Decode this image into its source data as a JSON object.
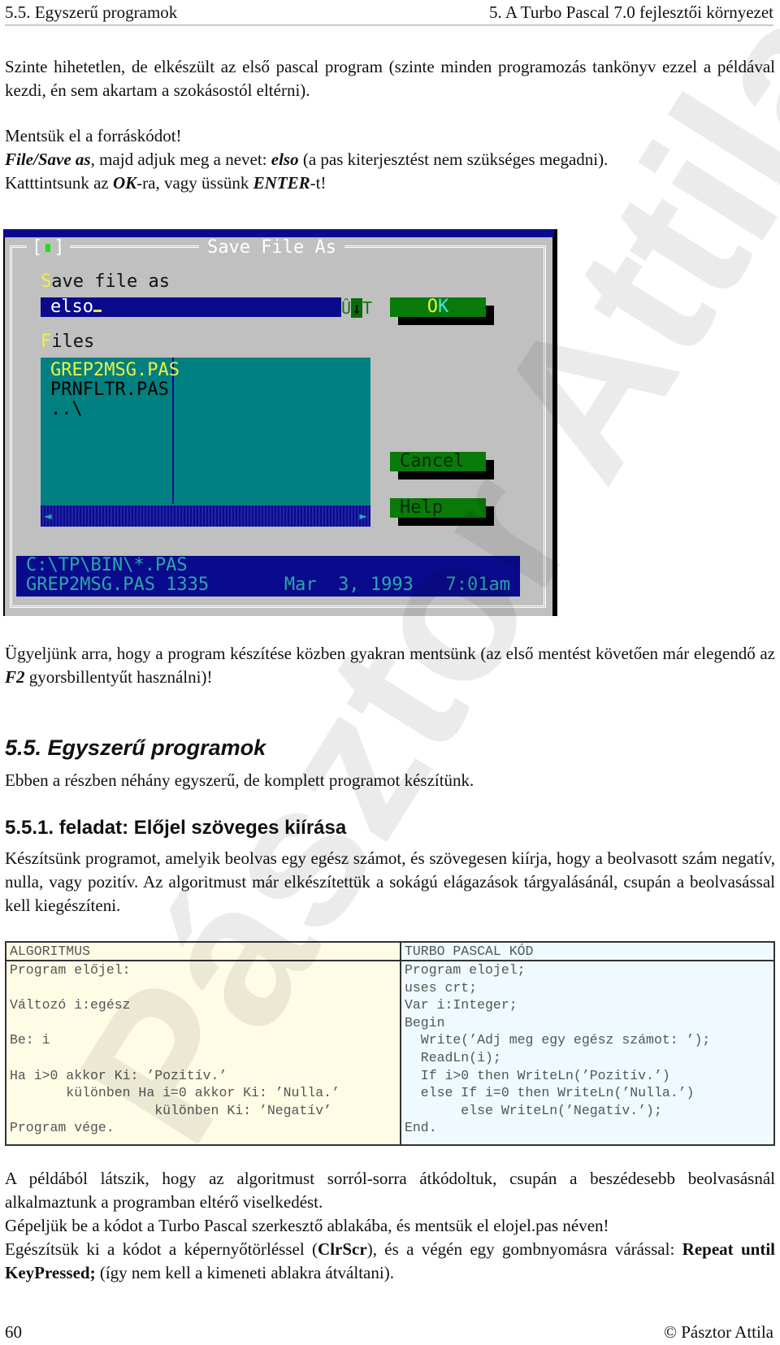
{
  "running_header": {
    "left": "5.5. Egyszerű programok",
    "right": "5. A Turbo Pascal 7.0 fejlesztői környezet"
  },
  "paragraphs": {
    "p1": "Szinte hihetetlen, de elkészült az első pascal program (szinte minden programozás tankönyv ezzel a példával kezdi, én sem akartam a szokásostól eltérni).",
    "p2_line1": "Mentsük el a forráskódot!",
    "p2_line2_bold1": "File/Save as",
    "p2_line2_text1": ", majd adjuk meg a nevet: ",
    "p2_line2_bold2": "elso",
    "p2_line2_text2": " (a pas kiterjesztést nem szükséges megadni).",
    "p2_line3_text1": "Katttintsunk az ",
    "p2_line3_bold1": "OK",
    "p2_line3_text2": "-ra, vagy üssünk ",
    "p2_line3_bold2": "ENTER",
    "p2_line3_text3": "-t!",
    "p3_text1": "Ügyeljünk arra, hogy a program készítése közben gyakran mentsünk (az első mentést követően már elegendő az ",
    "p3_bold": "F2",
    "p3_text2": " gyorsbillentyűt használni)!",
    "p4": "Ebben a részben néhány egyszerű, de komplett programot készítünk.",
    "p5": "Készítsünk programot, amelyik beolvas egy egész számot, és szövegesen kiírja, hogy a beolvasott szám negatív, nulla, vagy pozitív. Az algoritmust már elkészítettük a sokágú elágazások tárgyalásánál, csupán a beolvasással kell kiegészíteni.",
    "p6": "A példából látszik, hogy az algoritmust sorról-sorra átkódoltuk, csupán a beszédesebb beolvasásnál alkalmaztunk a programban eltérő viselkedést.",
    "p7": "Gépeljük be a kódot a Turbo Pascal szerkesztő ablakába, és mentsük el elojel.pas néven!",
    "p8_text1": "Egészítsük ki a kódot a képernyőtörléssel (",
    "p8_bold1": "ClrScr",
    "p8_text2": "), és a végén egy gombnyomásra várással: ",
    "p8_bold2": "Repeat until KeyPressed;",
    "p8_text3": " (így nem kell a kimeneti ablakra átváltani)."
  },
  "headings": {
    "section": "5.5. Egyszerű programok",
    "task": "5.5.1. feladat: Előjel szöveges kiírása"
  },
  "dialog": {
    "title": "Save File As",
    "close_icon": "close-box-icon",
    "save_label_hot": "S",
    "save_label_rest": "ave file as",
    "input_value": "elso",
    "history_glyphs": "Û",
    "history_arrow": "↓",
    "history_end": "T",
    "files_label_hot": "F",
    "files_label_rest": "iles",
    "files": [
      "GREP2MSG.PAS",
      "PRNFLTR.PAS",
      "..\\"
    ],
    "selected_file_index": 0,
    "buttons": {
      "ok_hot": "O",
      "ok_rest": "K",
      "cancel": "Cancel",
      "help": "Help"
    },
    "scroll_left_icon": "◄",
    "scroll_right_icon": "►",
    "status_path": "C:\\TP\\BIN\\*.PAS",
    "status_info": "GREP2MSG.PAS 1335       Mar  3, 1993   7:01am",
    "colors": {
      "dialog_bg": "#c0c0c0",
      "input_bg": "#0a0a8c",
      "list_bg": "#008080",
      "button_bg": "#0a7a0a",
      "hotkey": "#f0f040"
    }
  },
  "code_table": {
    "algorithm_header": "ALGORITMUS",
    "pascal_header": "TURBO PASCAL KÓD",
    "algorithm_lines": [
      "Program előjel:",
      "",
      "Változó i:egész",
      "",
      "Be: i",
      "",
      "Ha i>0 akkor Ki: ’Pozitív.’",
      "       különben Ha i=0 akkor Ki: ’Nulla.’",
      "                  különben Ki: ’Negatív’",
      "Program vége."
    ],
    "pascal_lines": [
      "Program elojel;",
      "uses crt;",
      "Var i:Integer;",
      "Begin",
      "  Write(’Adj meg egy egész számot: ’);",
      "  ReadLn(i);",
      "  If i>0 then WriteLn(’Pozitív.’)",
      "  else If i=0 then WriteLn(’Nulla.’)",
      "       else WriteLn(’Negatív.’);",
      "End."
    ]
  },
  "footer": {
    "page_number": "60",
    "copyright": "© Pásztor Attila"
  }
}
